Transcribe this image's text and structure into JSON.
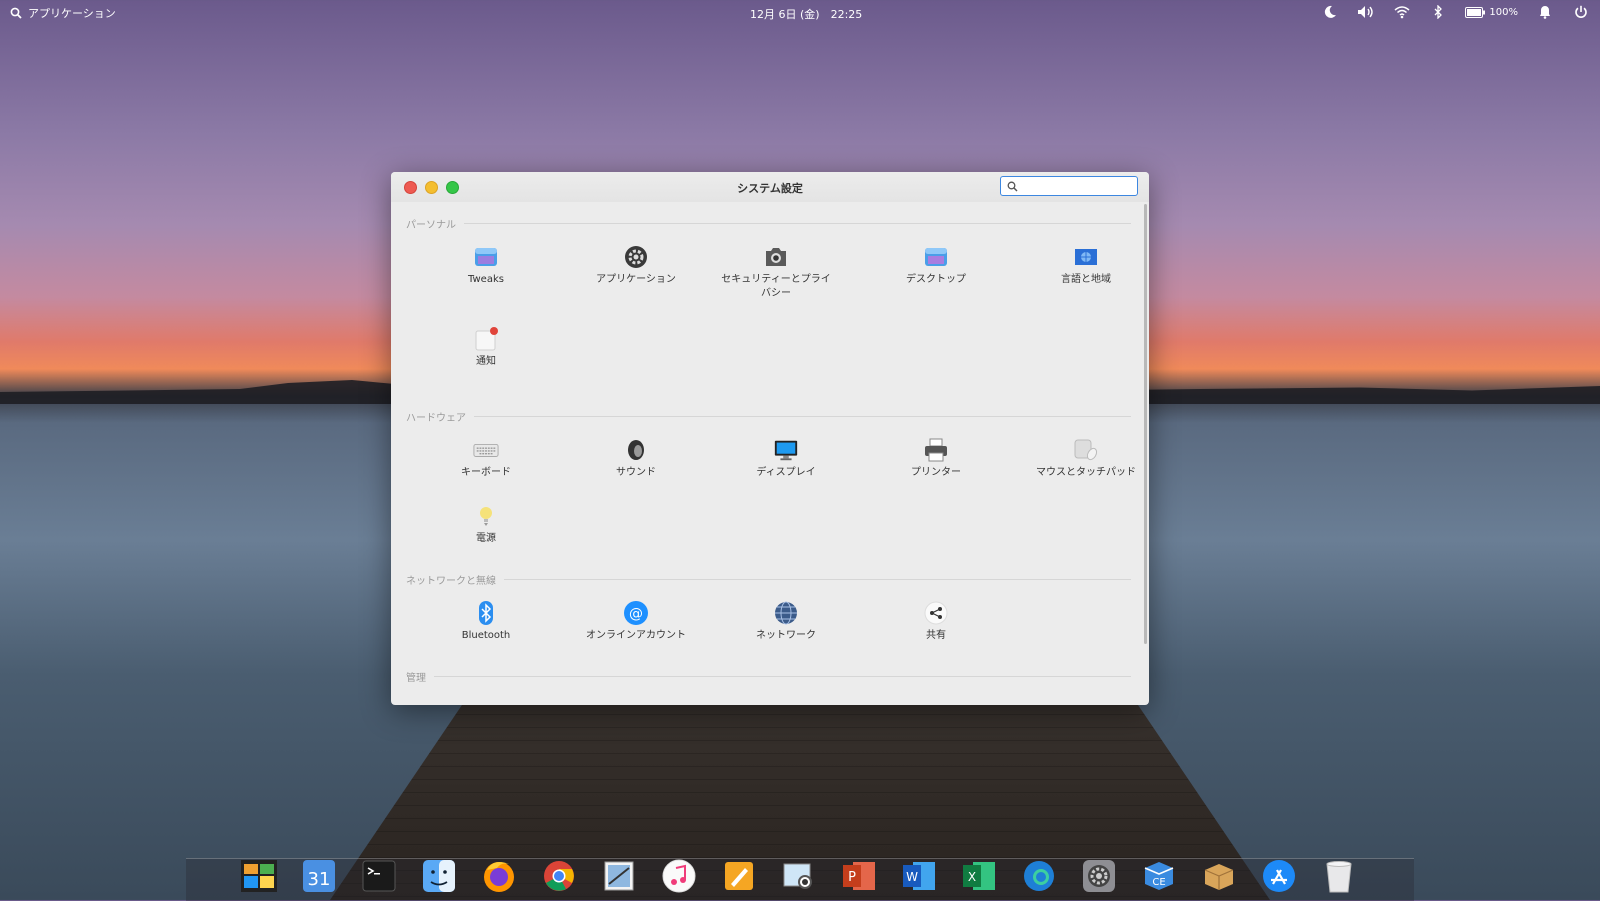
{
  "topbar": {
    "apps_label": "アプリケーション",
    "datetime": "12月 6日 (金)　22:25",
    "battery": "100%"
  },
  "window": {
    "title": "システム設定",
    "search_value": "",
    "sections": [
      {
        "title": "パーソナル",
        "items": [
          {
            "label": "Tweaks",
            "icon": "tweaks-icon"
          },
          {
            "label": "アプリケーション",
            "icon": "applications-icon"
          },
          {
            "label": "セキュリティーとプライバシー",
            "icon": "security-privacy-icon"
          },
          {
            "label": "デスクトップ",
            "icon": "desktop-icon"
          },
          {
            "label": "言語と地域",
            "icon": "language-region-icon"
          },
          {
            "label": "通知",
            "icon": "notifications-icon"
          }
        ]
      },
      {
        "title": "ハードウェア",
        "items": [
          {
            "label": "キーボード",
            "icon": "keyboard-icon"
          },
          {
            "label": "サウンド",
            "icon": "sound-icon"
          },
          {
            "label": "ディスプレイ",
            "icon": "display-icon"
          },
          {
            "label": "プリンター",
            "icon": "printer-icon"
          },
          {
            "label": "マウスとタッチパッド",
            "icon": "mouse-touchpad-icon"
          },
          {
            "label": "電源",
            "icon": "power-icon"
          }
        ]
      },
      {
        "title": "ネットワークと無線",
        "items": [
          {
            "label": "Bluetooth",
            "icon": "bluetooth-icon"
          },
          {
            "label": "オンラインアカウント",
            "icon": "online-accounts-icon"
          },
          {
            "label": "ネットワーク",
            "icon": "network-icon"
          },
          {
            "label": "共有",
            "icon": "sharing-icon"
          }
        ]
      },
      {
        "title": "管理",
        "items": []
      }
    ]
  },
  "dock": [
    "files-app-icon",
    "calendar-app-icon",
    "terminal-app-icon",
    "finder-app-icon",
    "firefox-app-icon",
    "chrome-app-icon",
    "mail-app-icon",
    "music-app-icon",
    "pages-app-icon",
    "preview-app-icon",
    "powerpoint-app-icon",
    "word-app-icon",
    "excel-app-icon",
    "edge-app-icon",
    "system-settings-app-icon",
    "archive-app-icon",
    "package-app-icon",
    "app-store-app-icon",
    "trash-app-icon"
  ],
  "calendar_day": "31"
}
